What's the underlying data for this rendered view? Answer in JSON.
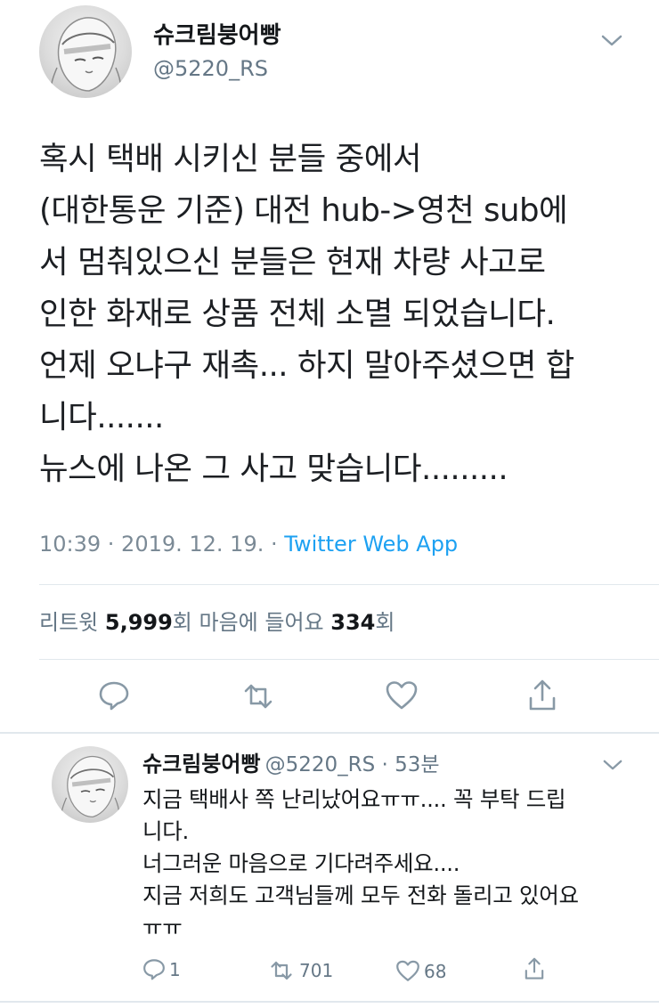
{
  "tweet": {
    "author_name": "슈크림붕어빵",
    "author_handle": "@5220_RS",
    "lines": [
      "혹시 택배 시키신 분들 중에서",
      "(대한통운 기준) 대전 hub->영천 sub에",
      "서 멈춰있으신 분들은 현재 차량 사고로",
      "인한 화재로 상품 전체 소멸 되었습니다.",
      "언제 오냐구 재촉... 하지 말아주셨으면 합",
      "니다.......",
      "뉴스에 나온 그 사고 맞습니다........."
    ],
    "timestamp": "10:39 · 2019. 12. 19. · ",
    "source": "Twitter Web App",
    "retweets_label": "리트윗 ",
    "retweets_count": "5,999",
    "retweets_suffix": "회  마음에 들어요 ",
    "likes_count": "334",
    "likes_suffix": "회"
  },
  "reply": {
    "author_name": "슈크림붕어빵",
    "author_handle": "@5220_RS · 53분",
    "lines": [
      "지금 택배사 쪽 난리났어요ㅠㅠ.... 꼭 부탁 드립",
      "니다.",
      "너그러운 마음으로 기다려주세요....",
      "지금 저희도 고객님들께 모두 전화 돌리고 있어요",
      "ㅠㅠ"
    ],
    "reply_count": "1",
    "retweet_count": "701",
    "like_count": "68"
  },
  "icons": {
    "menu": "chevron-down-icon",
    "reply": "reply-icon",
    "retweet": "retweet-icon",
    "like": "heart-icon",
    "share": "share-icon"
  },
  "colors": {
    "accent": "#1da1f2",
    "muted": "#657786",
    "divider": "#e1e8ed"
  }
}
